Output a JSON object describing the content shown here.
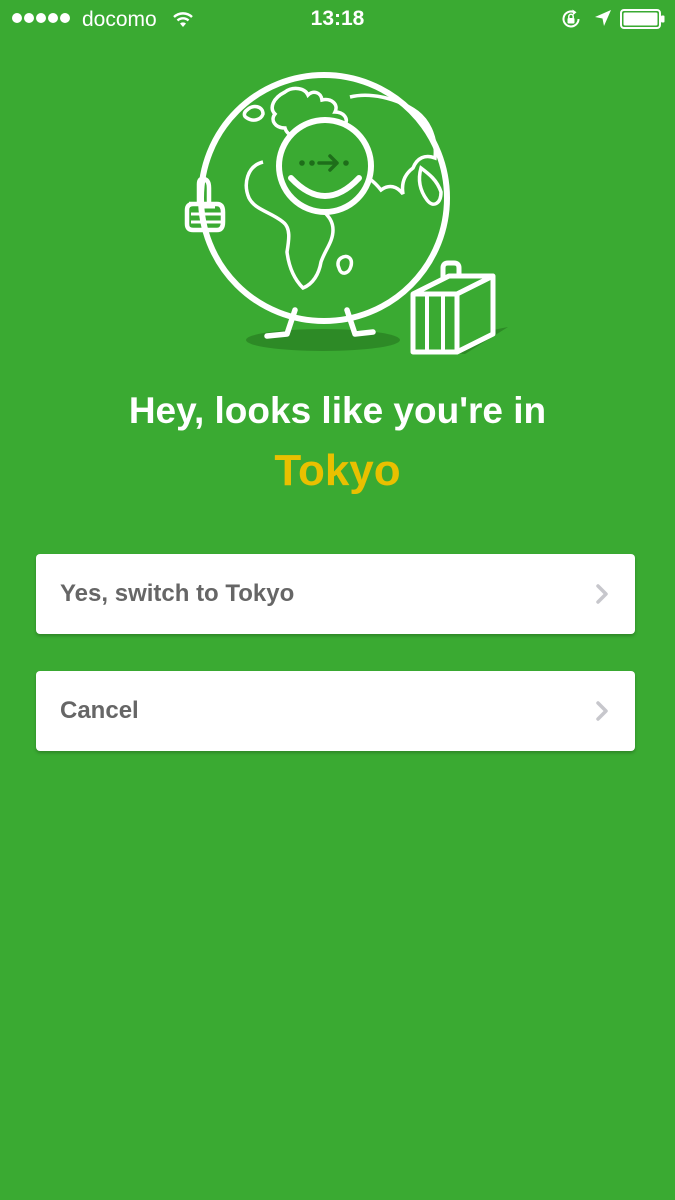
{
  "status_bar": {
    "carrier": "docomo",
    "time": "13:18",
    "signal_bars_filled": 5,
    "battery_level": 1.0,
    "icons": [
      "signal-dots-icon",
      "wifi-icon",
      "rotation-lock-icon",
      "location-arrow-icon",
      "battery-icon"
    ]
  },
  "illustration": {
    "description_icons": [
      "globe-mascot-icon",
      "thumbs-up-icon",
      "suitcase-icon"
    ]
  },
  "prompt": {
    "headline": "Hey, looks like you're in",
    "city": "Tokyo"
  },
  "options": [
    {
      "label": "Yes, switch to Tokyo",
      "icon": "chevron-right-icon"
    },
    {
      "label": "Cancel",
      "icon": "chevron-right-icon"
    }
  ],
  "colors": {
    "background": "#3aaa32",
    "city_text": "#e9c000",
    "button_text": "#666666",
    "button_background": "#ffffff",
    "chevron": "#c7c7cc"
  }
}
